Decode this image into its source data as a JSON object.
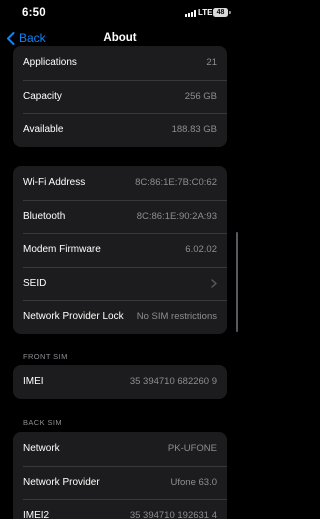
{
  "status_bar": {
    "time": "6:50",
    "network": "LTE",
    "battery": "48"
  },
  "nav": {
    "back_label": "Back",
    "title": "About"
  },
  "storage_group": [
    {
      "label": "Applications",
      "value": "21"
    },
    {
      "label": "Capacity",
      "value": "256 GB"
    },
    {
      "label": "Available",
      "value": "188.83 GB"
    }
  ],
  "network_group": {
    "wifi": {
      "label": "Wi-Fi Address",
      "value": "8C:86:1E:7B:C0:62"
    },
    "bluetooth": {
      "label": "Bluetooth",
      "value": "8C:86:1E:90:2A:93"
    },
    "modem": {
      "label": "Modem Firmware",
      "value": "6.02.02"
    },
    "seid": {
      "label": "SEID"
    },
    "carrier_lock": {
      "label": "Network Provider Lock",
      "value": "No SIM restrictions"
    }
  },
  "front_sim": {
    "header": "FRONT SIM",
    "imei": {
      "label": "IMEI",
      "value": "35 394710 682260 9"
    }
  },
  "back_sim": {
    "header": "BACK SIM",
    "network": {
      "label": "Network",
      "value": "PK-UFONE"
    },
    "provider": {
      "label": "Network Provider",
      "value": "Ufone 63.0"
    },
    "imei2": {
      "label": "IMEI2",
      "value": "35 394710 192631 4"
    }
  },
  "colors": {
    "accent": "#0a84ff",
    "background": "#000000",
    "cell": "#1c1c1e",
    "secondary_text": "#8e8e93"
  }
}
